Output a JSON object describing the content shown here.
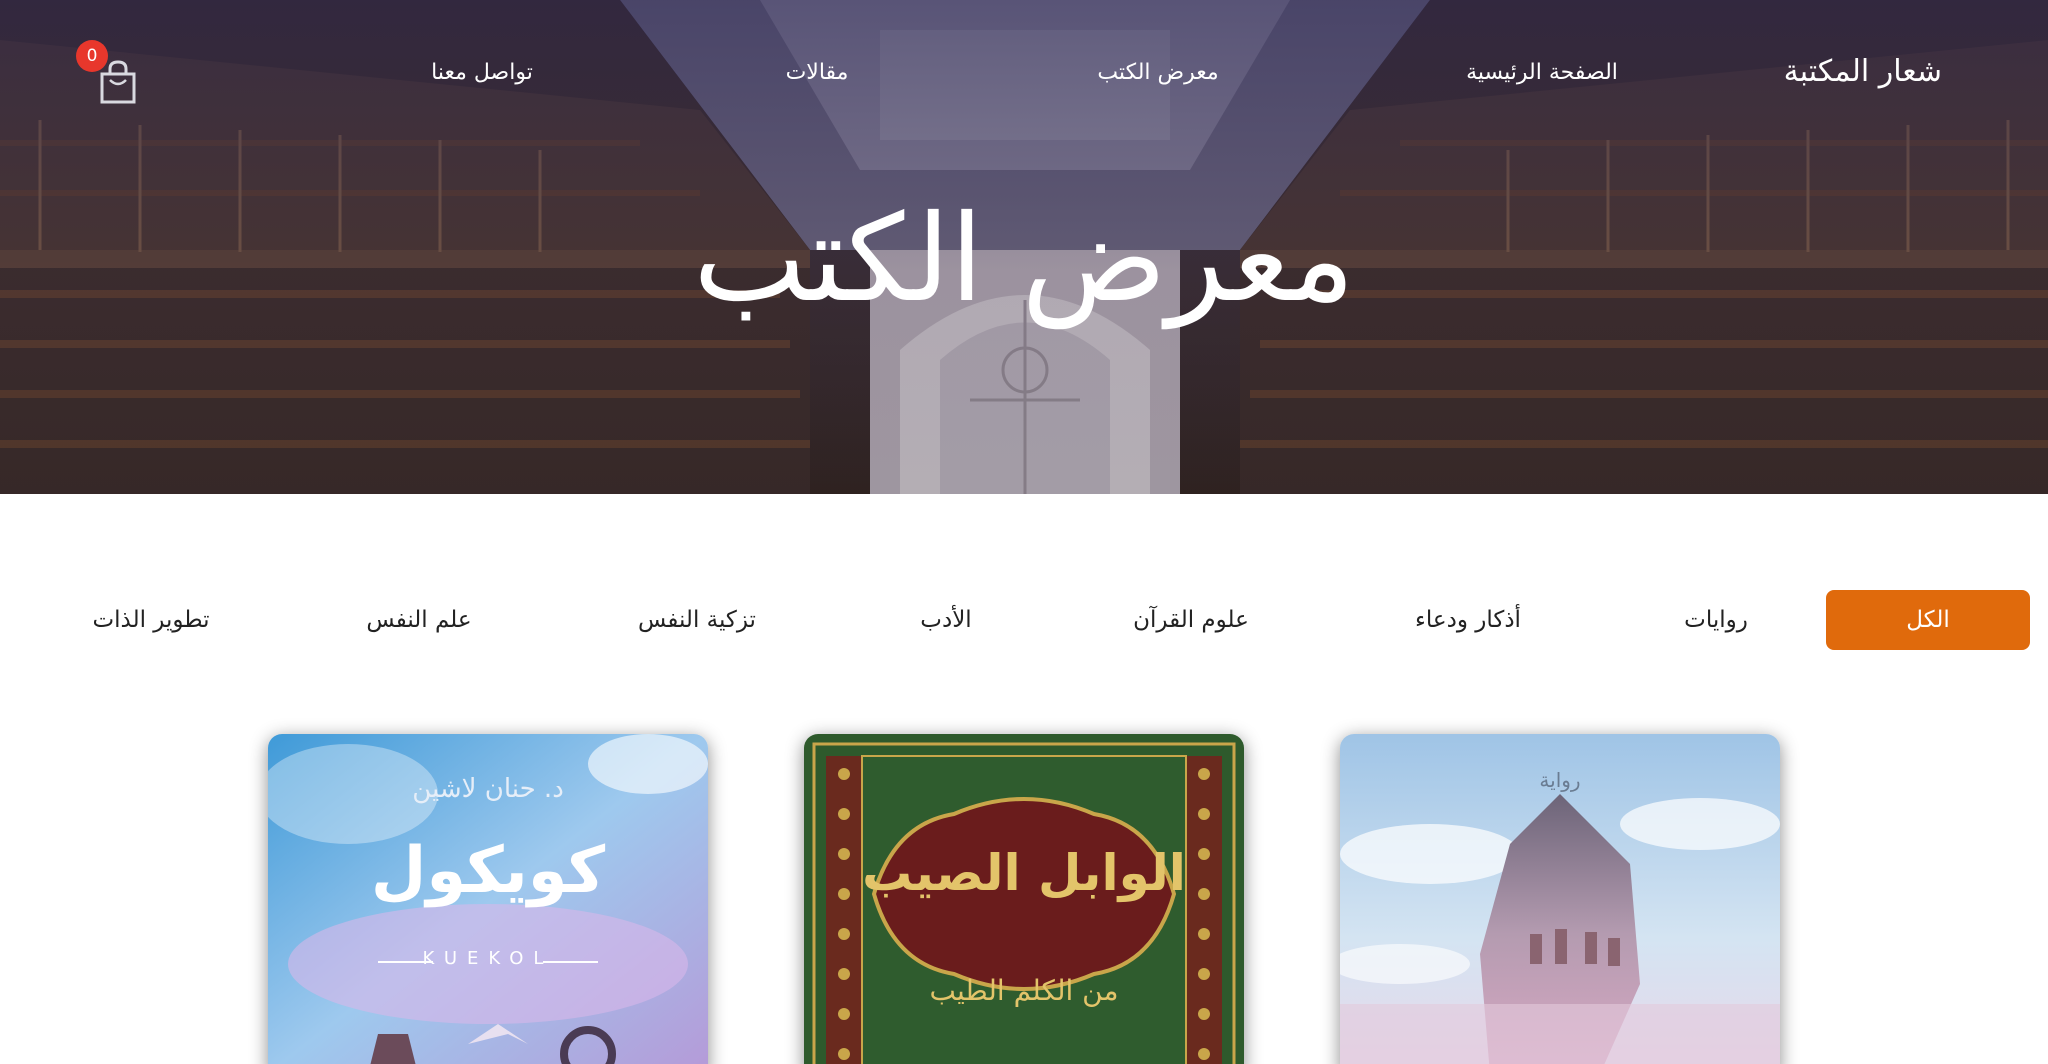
{
  "nav": {
    "logo": "شعار المكتبة",
    "links": [
      "الصفحة الرئيسية",
      "معرض الكتب",
      "مقالات",
      "تواصل معنا"
    ],
    "cart_count": "0"
  },
  "hero": {
    "title": "معرض الكتب"
  },
  "filters": {
    "active": "الكل",
    "items": [
      "روايات",
      "أذكار ودعاء",
      "علوم القرآن",
      "الأدب",
      "تزكية النفس",
      "علم النفس",
      "تطوير الذات"
    ]
  },
  "books": [
    {
      "cover_label": "رواية"
    },
    {
      "title": "الوابل الصيب",
      "subtitle": "من الكلم الطيب"
    },
    {
      "author": "د. حنان لاشين",
      "title": "كويكول",
      "latin": "KUEKOL"
    }
  ],
  "colors": {
    "accent": "#e06a0c",
    "badge": "#e8372c",
    "quran_green": "#2e5a2c"
  },
  "icons": {
    "cart": "shopping-bag-icon"
  }
}
